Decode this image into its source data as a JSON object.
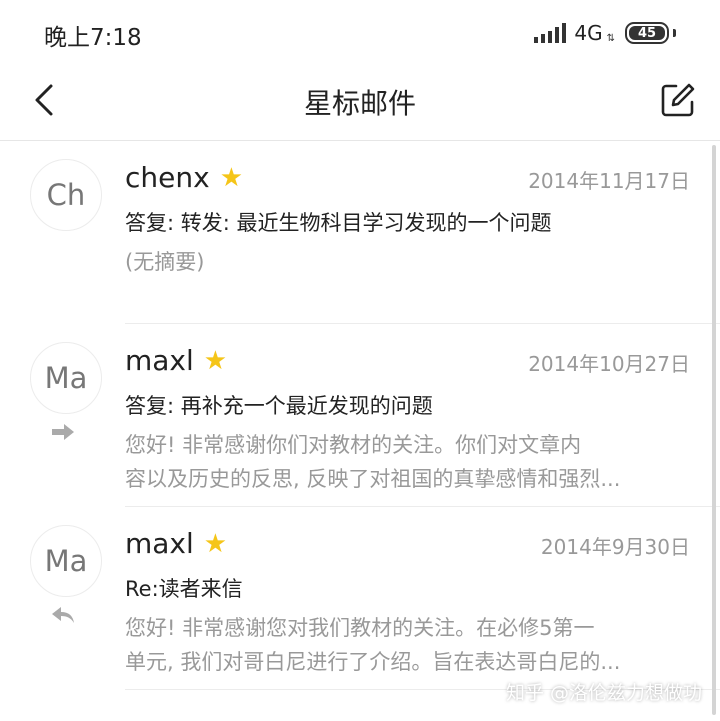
{
  "status_bar": {
    "time": "晚上7:18",
    "network": "4G",
    "battery": "45"
  },
  "header": {
    "title": "星标邮件"
  },
  "emails": [
    {
      "avatar": "Ch",
      "sender": "chenx",
      "starred": true,
      "date": "2014年11月17日",
      "subject": "答复:  转发: 最近生物科目学习发现的一个问题",
      "preview": [
        "(无摘要)"
      ]
    },
    {
      "avatar": "Ma",
      "sender": "maxl",
      "starred": true,
      "date": "2014年10月27日",
      "subject": "答复:  再补充一个最近发现的问题",
      "preview": [
        "您好!      非常感谢你们对教材的关注。你们对文章内",
        "容以及历史的反思, 反映了对祖国的真挚感情和强烈..."
      ],
      "status_icon": "forward-arrow-icon"
    },
    {
      "avatar": "Ma",
      "sender": "maxl",
      "starred": true,
      "date": "2014年9月30日",
      "subject": "Re:读者来信",
      "preview": [
        "您好!   非常感谢您对我们教材的关注。在必修5第一",
        "单元, 我们对哥白尼进行了介绍。旨在表达哥白尼的..."
      ],
      "status_icon": "reply-arrow-icon"
    }
  ],
  "watermark": "知乎 @洛伦兹力想做功",
  "colors": {
    "star": "#f5c518",
    "secondary_text": "#999999",
    "divider": "#ececec"
  }
}
